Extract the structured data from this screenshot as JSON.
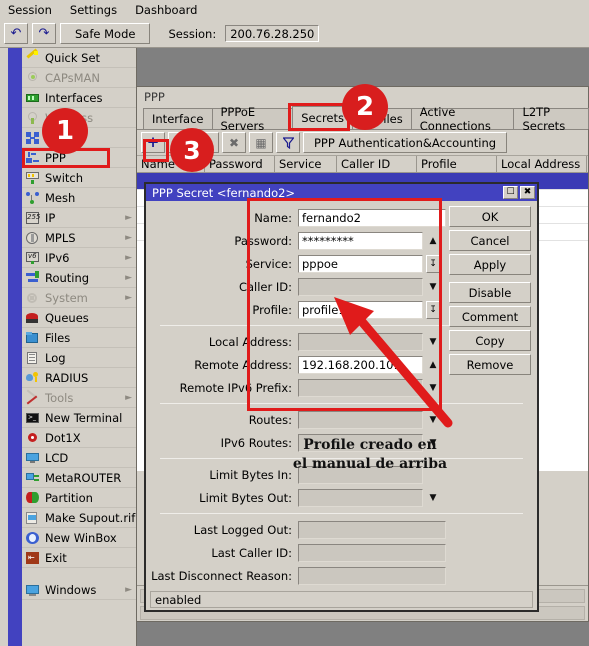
{
  "menubar": {
    "items": [
      "Session",
      "Settings",
      "Dashboard"
    ]
  },
  "toolbar": {
    "undo_icon": "undo-arrow-icon",
    "redo_icon": "redo-arrow-icon",
    "safe_mode_label": "Safe Mode",
    "session_label": "Session:",
    "session_value": "200.76.28.250"
  },
  "sidebar": {
    "items": [
      {
        "label": "Quick Set",
        "icon": "wand-icon",
        "chevron": false,
        "dim": false
      },
      {
        "label": "CAPsMAN",
        "icon": "antenna-icon",
        "chevron": false,
        "dim": true
      },
      {
        "label": "Interfaces",
        "icon": "interfaces-icon",
        "chevron": false,
        "dim": false
      },
      {
        "label": "Wireless",
        "icon": "wireless-icon",
        "chevron": false,
        "dim": true
      },
      {
        "label": "Bridge",
        "icon": "bridge-icon",
        "chevron": false,
        "dim": false
      },
      {
        "label": "PPP",
        "icon": "ppp-icon",
        "chevron": false,
        "dim": false
      },
      {
        "label": "Switch",
        "icon": "switch-icon",
        "chevron": false,
        "dim": false
      },
      {
        "label": "Mesh",
        "icon": "mesh-icon",
        "chevron": false,
        "dim": false
      },
      {
        "label": "IP",
        "icon": "ip-icon",
        "chevron": true,
        "dim": false
      },
      {
        "label": "MPLS",
        "icon": "mpls-icon",
        "chevron": true,
        "dim": false
      },
      {
        "label": "IPv6",
        "icon": "ipv6-icon",
        "chevron": true,
        "dim": false
      },
      {
        "label": "Routing",
        "icon": "routing-icon",
        "chevron": true,
        "dim": false
      },
      {
        "label": "System",
        "icon": "system-icon",
        "chevron": true,
        "dim": true
      },
      {
        "label": "Queues",
        "icon": "queues-icon",
        "chevron": false,
        "dim": false
      },
      {
        "label": "Files",
        "icon": "files-icon",
        "chevron": false,
        "dim": false
      },
      {
        "label": "Log",
        "icon": "log-icon",
        "chevron": false,
        "dim": false
      },
      {
        "label": "RADIUS",
        "icon": "radius-icon",
        "chevron": false,
        "dim": false
      },
      {
        "label": "Tools",
        "icon": "tools-icon",
        "chevron": true,
        "dim": true
      },
      {
        "label": "New Terminal",
        "icon": "terminal-icon",
        "chevron": false,
        "dim": false
      },
      {
        "label": "Dot1X",
        "icon": "dot1x-icon",
        "chevron": false,
        "dim": false
      },
      {
        "label": "LCD",
        "icon": "lcd-icon",
        "chevron": false,
        "dim": false
      },
      {
        "label": "MetaROUTER",
        "icon": "metarouter-icon",
        "chevron": false,
        "dim": false
      },
      {
        "label": "Partition",
        "icon": "partition-icon",
        "chevron": false,
        "dim": false
      },
      {
        "label": "Make Supout.rif",
        "icon": "supout-icon",
        "chevron": false,
        "dim": false
      },
      {
        "label": "New WinBox",
        "icon": "winbox-icon",
        "chevron": false,
        "dim": false
      },
      {
        "label": "Exit",
        "icon": "exit-icon",
        "chevron": false,
        "dim": false
      }
    ],
    "windows_item": {
      "label": "Windows",
      "icon": "windows-icon",
      "chevron": true
    }
  },
  "ppp_window": {
    "title": "PPP",
    "tabs": [
      {
        "label": "Interface",
        "active": false
      },
      {
        "label": "PPPoE Servers",
        "active": false
      },
      {
        "label": "Secrets",
        "active": true
      },
      {
        "label": "Profiles",
        "active": false
      },
      {
        "label": "Active Connections",
        "active": false
      },
      {
        "label": "L2TP Secrets",
        "active": false
      }
    ],
    "toolbar": {
      "add_icon": "plus-icon",
      "remove_icon": "minus-icon",
      "check_icon": "enable-check-icon",
      "disable_icon": "disable-x-icon",
      "comment_icon": "comment-icon",
      "filter_icon": "filter-funnel-icon",
      "auth_label": "PPP Authentication&Accounting"
    },
    "table": {
      "columns": [
        "Name",
        "Password",
        "Service",
        "Caller ID",
        "Profile",
        "Local Address"
      ],
      "sort_column": "Name",
      "sort_indicator": "ascending-triangle-icon",
      "rows": []
    }
  },
  "dialog": {
    "title": "PPP Secret <fernando2>",
    "maximize_icon": "maximize-icon",
    "close_icon": "close-icon",
    "fields": [
      {
        "label": "Name:",
        "value": "fernando2",
        "readonly": false,
        "control": "none",
        "group": 1
      },
      {
        "label": "Password:",
        "value": "*********",
        "readonly": false,
        "control": "up",
        "group": 1
      },
      {
        "label": "Service:",
        "value": "pppoe",
        "readonly": false,
        "control": "spin",
        "group": 1
      },
      {
        "label": "Caller ID:",
        "value": "",
        "readonly": true,
        "control": "down",
        "group": 1
      },
      {
        "label": "Profile:",
        "value": "profile1",
        "readonly": false,
        "control": "spin",
        "group": 1
      },
      {
        "label": "Local Address:",
        "value": "",
        "readonly": true,
        "control": "down",
        "group": 2
      },
      {
        "label": "Remote Address:",
        "value": "192.168.200.101",
        "readonly": false,
        "control": "up",
        "group": 2
      },
      {
        "label": "Remote IPv6 Prefix:",
        "value": "",
        "readonly": true,
        "control": "down",
        "group": 2
      },
      {
        "label": "Routes:",
        "value": "",
        "readonly": true,
        "control": "down",
        "group": 3
      },
      {
        "label": "IPv6 Routes:",
        "value": "",
        "readonly": true,
        "control": "down",
        "group": 3
      },
      {
        "label": "Limit Bytes In:",
        "value": "",
        "readonly": true,
        "control": "none",
        "group": 4
      },
      {
        "label": "Limit Bytes Out:",
        "value": "",
        "readonly": true,
        "control": "down",
        "group": 4
      },
      {
        "label": "Last Logged Out:",
        "value": "",
        "readonly": true,
        "control": "none",
        "group": 5
      },
      {
        "label": "Last Caller ID:",
        "value": "",
        "readonly": true,
        "control": "none",
        "group": 5
      },
      {
        "label": "Last Disconnect Reason:",
        "value": "",
        "readonly": true,
        "control": "none",
        "group": 5
      }
    ],
    "buttons": [
      "OK",
      "Cancel",
      "Apply",
      "Disable",
      "Comment",
      "Copy",
      "Remove"
    ],
    "status": "enabled"
  },
  "annotations": {
    "badges": [
      {
        "number": "1"
      },
      {
        "number": "2"
      },
      {
        "number": "3"
      }
    ],
    "note": "Profile creado en\nel manual de arriba",
    "highlight_color": "#e01b1b",
    "badge_color": "#d81e1e"
  }
}
